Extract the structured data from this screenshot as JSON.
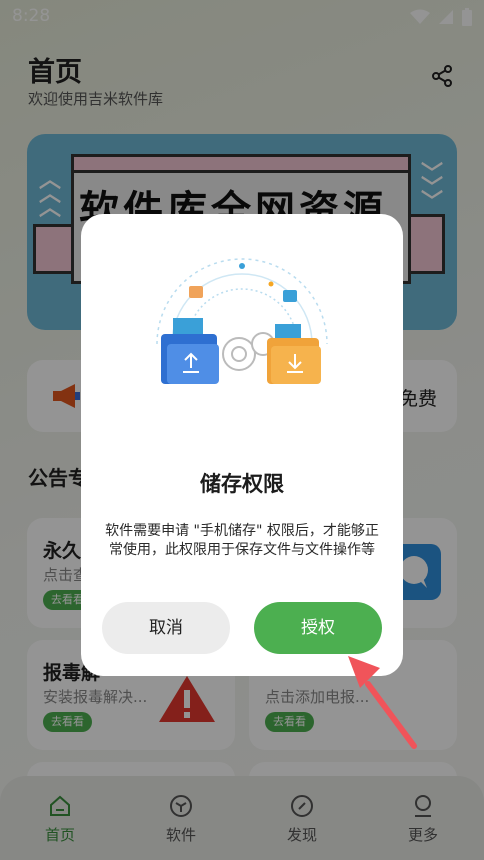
{
  "status_bar": {
    "time": "8:28"
  },
  "header": {
    "title": "首页",
    "subtitle": "欢迎使用吉米软件库"
  },
  "banner": {
    "headline": "软件库全网资源"
  },
  "notice": {
    "text": "免费"
  },
  "section": {
    "title": "公告专"
  },
  "cards": [
    {
      "title": "永久",
      "subtitle": "点击查",
      "button": "去看看"
    },
    {
      "title": "",
      "subtitle": "",
      "button": ""
    },
    {
      "title": "报毒解",
      "subtitle": "安装报毒解决...",
      "button": "去看看"
    },
    {
      "title": "",
      "subtitle": "点击添加电报...",
      "button": "去看看"
    }
  ],
  "dialog": {
    "title": "储存权限",
    "message": "软件需要申请 \"手机储存\" 权限后，才能够正常使用，此权限用于保存文件与文件操作等",
    "cancel_label": "取消",
    "confirm_label": "授权"
  },
  "bottom_nav": [
    {
      "label": "首页",
      "icon": "home-icon",
      "active": true
    },
    {
      "label": "软件",
      "icon": "software-icon",
      "active": false
    },
    {
      "label": "发现",
      "icon": "compass-icon",
      "active": false
    },
    {
      "label": "更多",
      "icon": "user-icon",
      "active": false
    }
  ],
  "colors": {
    "accent": "#4caf50",
    "active_nav": "#3a8f3d",
    "annotation_arrow": "#f0545a"
  }
}
